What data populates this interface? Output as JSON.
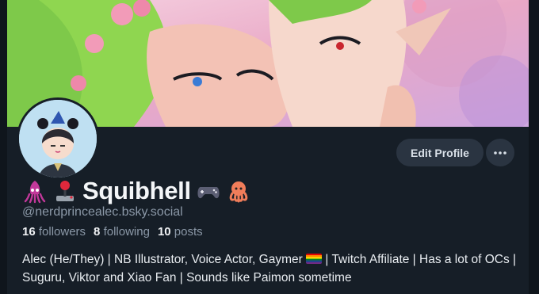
{
  "profile": {
    "display_name": "Squibhell",
    "handle": "@nerdprincealec.bsky.social",
    "name_icons": [
      "squid-emoji-icon",
      "joystick-emoji-icon",
      "gamepad-emoji-icon",
      "octopus-emoji-icon"
    ],
    "stats": {
      "followers_count": "16",
      "followers_label": "followers",
      "following_count": "8",
      "following_label": "following",
      "posts_count": "10",
      "posts_label": "posts"
    },
    "bio_part1": "Alec (He/They) | NB Illustrator, Voice Actor, Gaymer",
    "bio_flag_icon": "rainbow-flag-icon",
    "bio_part2": "| Twitch Affiliate | Has a lot of OCs | Suguru, Viktor and Xiao Fan | Sounds like Paimon sometime"
  },
  "actions": {
    "edit_profile_label": "Edit Profile",
    "more_icon": "more-horizontal-icon"
  },
  "colors": {
    "background": "#161e27",
    "button_bg": "#2a3441",
    "muted_text": "#8b98a7"
  }
}
